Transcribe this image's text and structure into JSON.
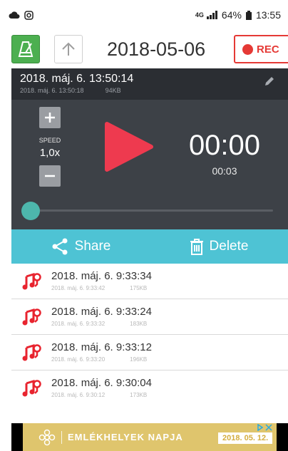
{
  "status": {
    "network_type": "4G",
    "battery": "64%",
    "time": "13:55"
  },
  "toolbar": {
    "folder_date": "2018-05-06",
    "rec_label": "REC",
    "icons": [
      "metronome-icon",
      "arrow-up-icon",
      "record-dot-icon"
    ]
  },
  "player": {
    "title": "2018. máj. 6. 13:50:14",
    "subtitle_date": "2018. máj. 6. 13:50:18",
    "size": "94KB",
    "speed_label": "SPEED",
    "speed_value": "1,0x",
    "elapsed": "00:00",
    "duration": "00:03",
    "progress": 0,
    "accent": "#4db6ac",
    "play_color": "#ee3a4f"
  },
  "actions": {
    "share_label": "Share",
    "delete_label": "Delete",
    "bar_color": "#4ec3d4"
  },
  "files": [
    {
      "name": "2018. máj. 6. 9:33:34",
      "meta_date": "2018. máj. 6. 9:33:42",
      "size": "175KB"
    },
    {
      "name": "2018. máj. 6. 9:33:24",
      "meta_date": "2018. máj. 6. 9:33:32",
      "size": "183KB"
    },
    {
      "name": "2018. máj. 6. 9:33:12",
      "meta_date": "2018. máj. 6. 9:33:20",
      "size": "196KB"
    },
    {
      "name": "2018. máj. 6. 9:30:04",
      "meta_date": "2018. máj. 6. 9:30:12",
      "size": "173KB"
    }
  ],
  "ad": {
    "text": "EMLÉKHELYEK NAPJA",
    "date": "2018. 05. 12."
  }
}
